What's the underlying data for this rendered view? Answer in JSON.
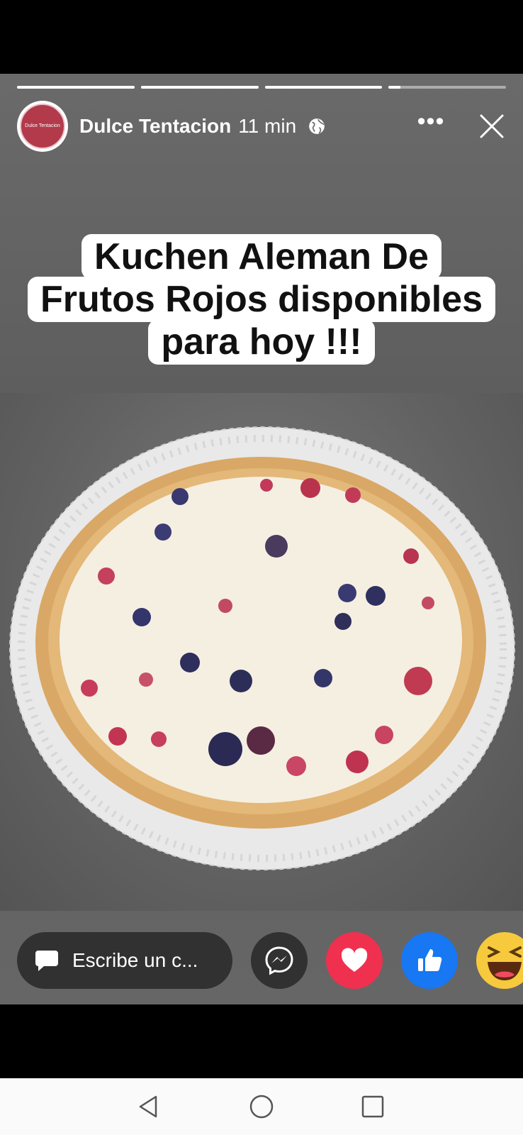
{
  "story": {
    "progress": [
      1,
      1,
      1,
      0.1
    ],
    "author": "Dulce Tentacion",
    "time": "11 min",
    "avatar_text": [
      "Dulce Tentacion"
    ],
    "caption_lines": [
      "Kuchen Aleman De",
      "Frutos Rojos disponibles",
      "para hoy !!!"
    ]
  },
  "reply": {
    "placeholder": "Escribe un c...",
    "reactions": [
      "messenger-icon",
      "love-icon",
      "like-icon",
      "haha-icon"
    ]
  },
  "icons": {
    "privacy": "globe-icon",
    "more": "more-icon",
    "close": "close-icon"
  },
  "colors": {
    "love": "#f0304f",
    "like": "#1877f2",
    "haha": "#f7c93c"
  }
}
